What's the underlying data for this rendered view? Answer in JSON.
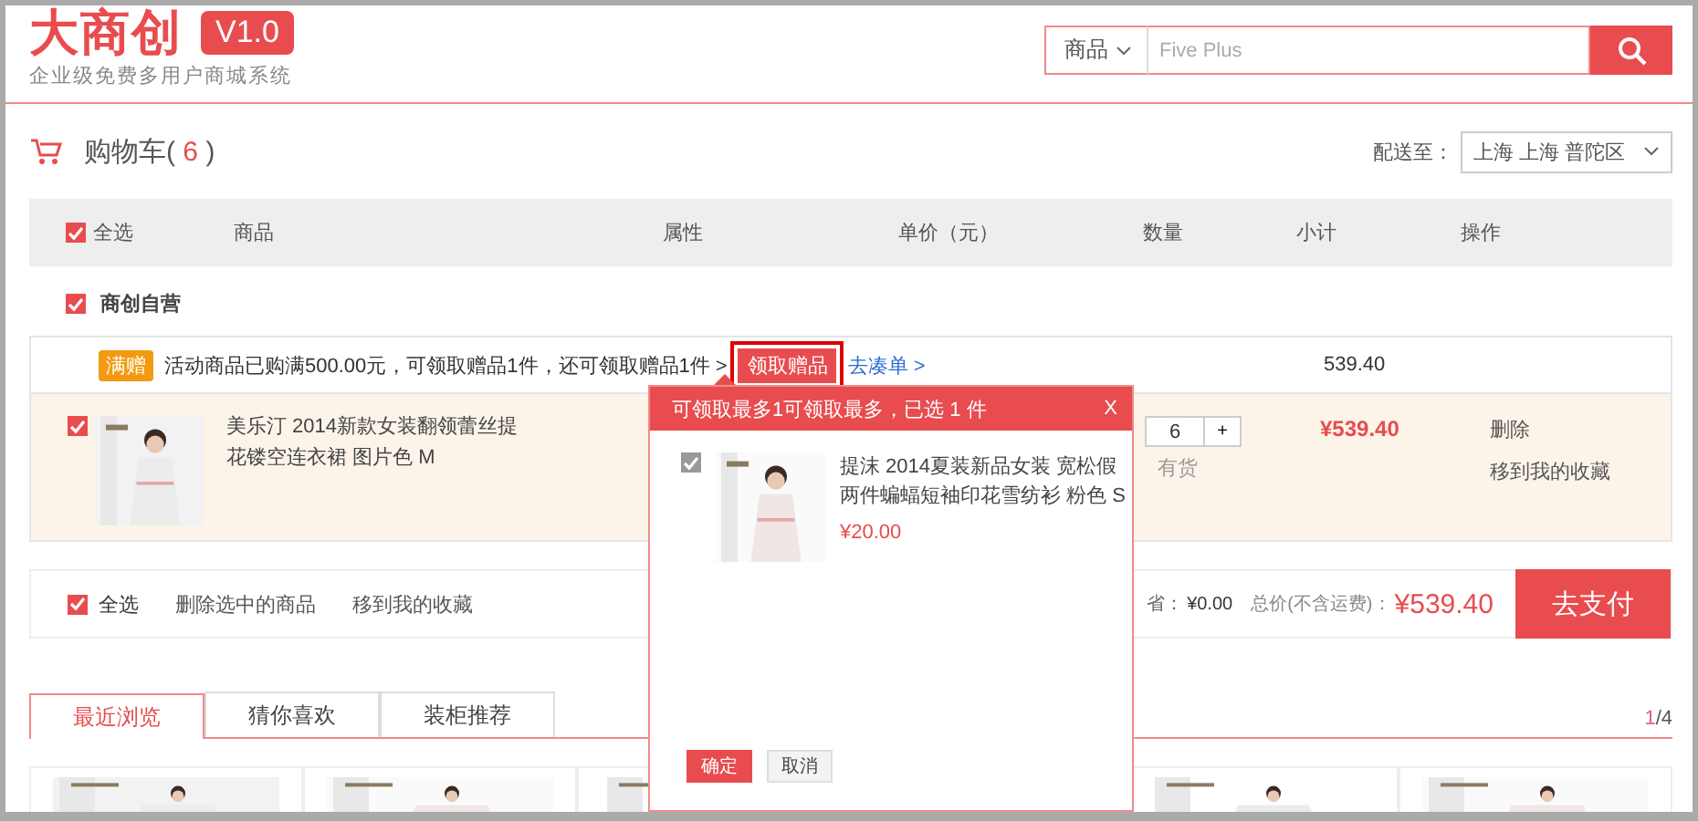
{
  "header": {
    "logo": "大商创",
    "version": "V1.0",
    "slogan": "企业级免费多用户商城系统",
    "search": {
      "category": "商品",
      "placeholder": "Five Plus"
    }
  },
  "cart": {
    "title": "购物车(",
    "count": "6",
    "title_end": ")"
  },
  "delivery": {
    "label": "配送至：",
    "region": "上海 上海 普陀区"
  },
  "table": {
    "select_all": {
      "label": "全选",
      "checked": true
    },
    "columns": [
      "商品",
      "属性",
      "单价（元）",
      "数量",
      "小计",
      "操作"
    ]
  },
  "store": {
    "name": "商创自营",
    "checked": true
  },
  "promo": {
    "tag": "满赠",
    "text": "活动商品已购满500.00元，可领取赠品1件，还可领取赠品1件 >",
    "gift_button": "领取赠品",
    "link": "去凑单 >",
    "subtotal": "539.40"
  },
  "items": [
    {
      "checked": true,
      "title": "美乐汀 2014新款女装翻领蕾丝提花镂空连衣裙 图片色 M",
      "quantity": "6",
      "plus": "+",
      "stock": "有货",
      "subtotal": "¥539.40",
      "actions": [
        "删除",
        "移到我的收藏"
      ]
    }
  ],
  "footer_bar": {
    "select_all": {
      "label": "全选",
      "checked": true
    },
    "actions": [
      "删除选中的商品",
      "移到我的收藏"
    ],
    "saved_label": "省：",
    "saved": "¥0.00",
    "total_label": "总价(不含运费)：",
    "total": "¥539.40",
    "pay_button": "去支付"
  },
  "recommend": {
    "tabs": [
      {
        "label": "最近浏览",
        "selected": true
      },
      {
        "label": "猜你喜欢",
        "selected": false
      },
      {
        "label": "装柜推荐",
        "selected": false
      }
    ],
    "page": "1",
    "pages": "/4",
    "cards": [
      {
        "kind": "picture"
      },
      {
        "kind": "picture"
      },
      {
        "kind": "picture"
      },
      {
        "kind": "covered"
      },
      {
        "kind": "picture"
      },
      {
        "kind": "picture"
      }
    ]
  },
  "popup": {
    "title": "可领取最多1可领取最多，已选 1 件",
    "close": "X",
    "gifts": [
      {
        "checked": true,
        "title": "提沫 2014夏装新品女装 宽松假两件蝙蝠短袖印花雪纺衫 粉色 S",
        "price": "¥20.00"
      }
    ],
    "buttons": [
      {
        "kind": "primary",
        "label": "确定"
      },
      {
        "kind": "secondary",
        "label": "取消"
      }
    ]
  }
}
